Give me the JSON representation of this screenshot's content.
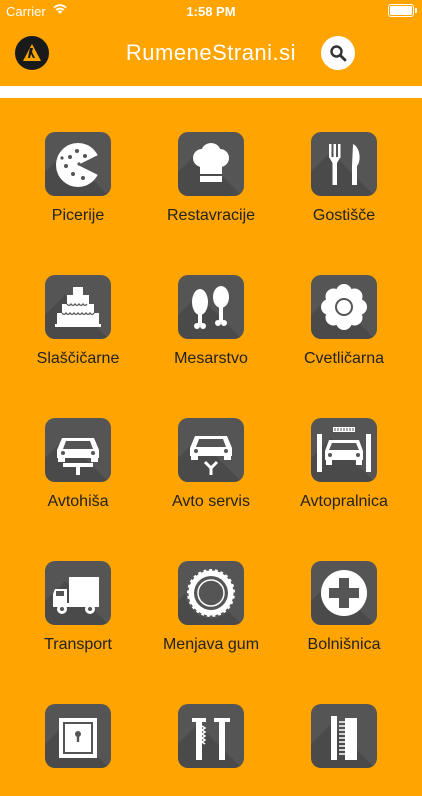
{
  "status_bar": {
    "carrier": "Carrier",
    "time": "1:58 PM"
  },
  "header": {
    "title": "RumeneStrani.si",
    "logo_icon": "walking-fingers-logo",
    "search_icon": "search-icon"
  },
  "colors": {
    "background": "#FFA400",
    "tile": "#555555",
    "text_dark": "#222222",
    "white": "#FFFFFF"
  },
  "categories": [
    {
      "label": "Picerije",
      "icon": "pizza-icon"
    },
    {
      "label": "Restavracije",
      "icon": "chef-hat-icon"
    },
    {
      "label": "Gostišče",
      "icon": "fork-knife-icon"
    },
    {
      "label": "Slaščičarne",
      "icon": "cake-icon"
    },
    {
      "label": "Mesarstvo",
      "icon": "meat-icon"
    },
    {
      "label": "Cvetličarna",
      "icon": "flower-icon"
    },
    {
      "label": "Avtohiša",
      "icon": "car-lift-icon"
    },
    {
      "label": "Avto servis",
      "icon": "car-wrench-icon"
    },
    {
      "label": "Avtopralnica",
      "icon": "car-wash-icon"
    },
    {
      "label": "Transport",
      "icon": "truck-icon"
    },
    {
      "label": "Menjava gum",
      "icon": "tire-icon"
    },
    {
      "label": "Bolnišnica",
      "icon": "medical-cross-icon"
    },
    {
      "label": "",
      "icon": "safe-icon"
    },
    {
      "label": "",
      "icon": "tools-icon"
    },
    {
      "label": "",
      "icon": "comb-icon"
    }
  ]
}
